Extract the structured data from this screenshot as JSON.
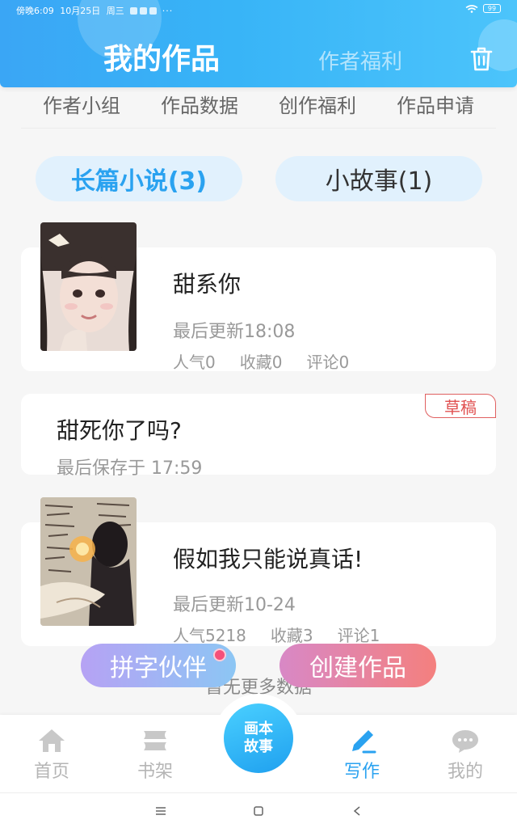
{
  "status_bar": {
    "time": "傍晚6:09",
    "date": "10月25日",
    "weekday": "周三",
    "more": "···",
    "battery": "99"
  },
  "header": {
    "active_tab": "我的作品",
    "other_tab": "作者福利",
    "trash_icon": "trash-icon"
  },
  "submenu": {
    "items": [
      "作者小组",
      "作品数据",
      "创作福利",
      "作品申请"
    ]
  },
  "categories": {
    "long_novel": "长篇小说(3)",
    "short_story": "小故事(1)"
  },
  "works": [
    {
      "title": "甜系你",
      "updated": "最后更新18:08",
      "popularity": "人气0",
      "favorites": "收藏0",
      "comments": "评论0"
    },
    {
      "title": "甜死你了吗?",
      "saved": "最后保存于 17:59",
      "badge": "草稿"
    },
    {
      "title": "假如我只能说真话!",
      "updated": "最后更新10-24",
      "popularity": "人气5218",
      "favorites": "收藏3",
      "comments": "评论1"
    }
  ],
  "floating": {
    "partner": "拼字伙伴",
    "create": "创建作品",
    "load_more": "暂无更多数据"
  },
  "bottom_nav": {
    "home": "首页",
    "bookshelf": "书架",
    "center_line1": "画本",
    "center_line2": "故事",
    "write": "写作",
    "mine": "我的"
  },
  "colors": {
    "accent": "#2aa2f0",
    "header_gradient_start": "#3aa6f5",
    "draft_red": "#e05050",
    "create_gradient": "#f4807e",
    "partner_gradient": "#b6a2f4"
  }
}
